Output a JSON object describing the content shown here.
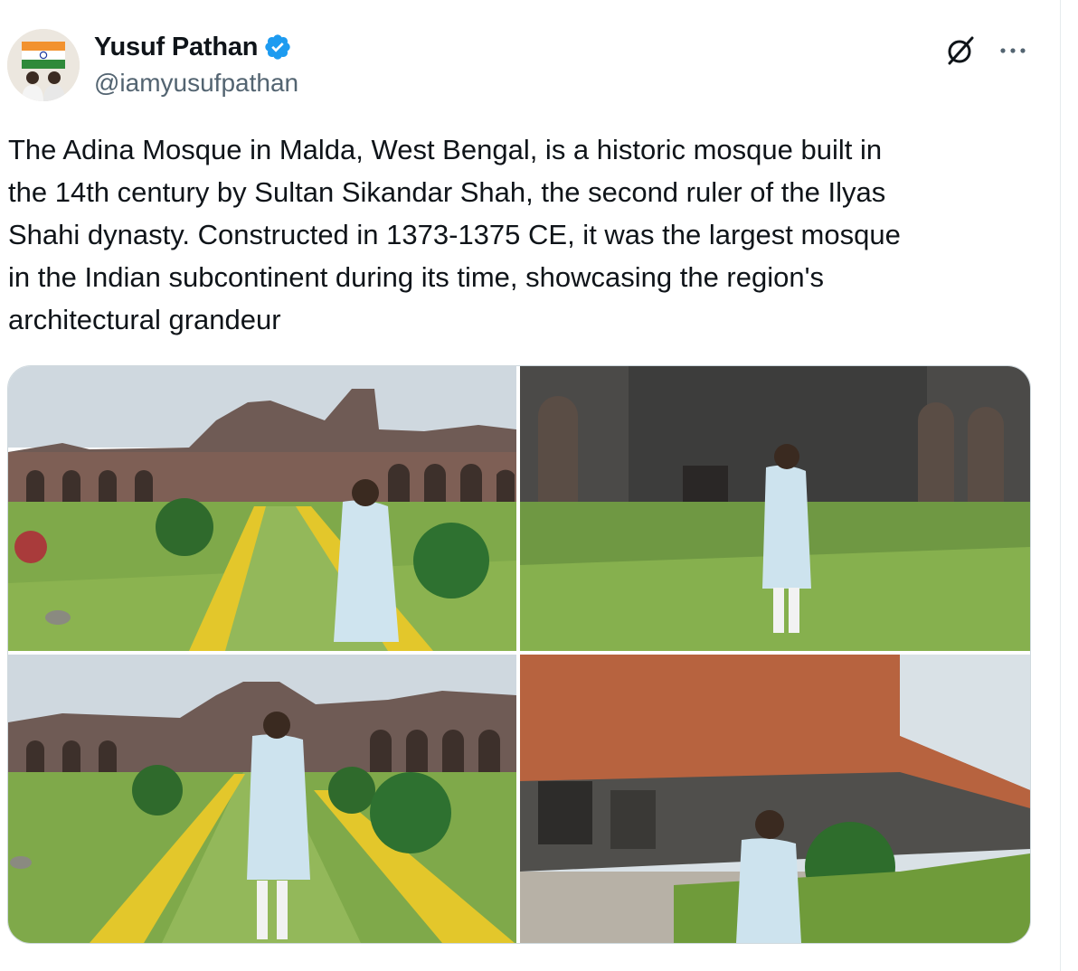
{
  "author": {
    "display_name": "Yusuf Pathan",
    "handle": "@iamyusufpathan",
    "verified": true,
    "avatar_icon": "profile-photo-with-india-flag"
  },
  "actions": {
    "grok_icon": "grok-icon",
    "more_icon": "more-dots-icon"
  },
  "tweet": {
    "text": "The Adina Mosque in Malda, West Bengal, is a historic mosque built in\nthe 14th century by Sultan Sikandar Shah, the second ruler of the Ilyas\nShahi dynasty. Constructed in 1373-1375 CE, it was the largest mosque\nin the Indian subcontinent during its time, showcasing the region's\narchitectural grandeur"
  },
  "media": {
    "count": 4,
    "photos": [
      {
        "subject": "man-in-white-kurta-garden-walkway-mosque-ruins"
      },
      {
        "subject": "man-in-white-kurta-mosque-courtyard-lawn"
      },
      {
        "subject": "man-in-white-kurta-center-garden-path-ruins"
      },
      {
        "subject": "man-in-white-kurta-beside-brick-mosque-wall"
      }
    ]
  },
  "colors": {
    "verified_blue": "#1d9bf0",
    "text_primary": "#0f1419",
    "text_secondary": "#536471",
    "border": "#cfd9de"
  }
}
